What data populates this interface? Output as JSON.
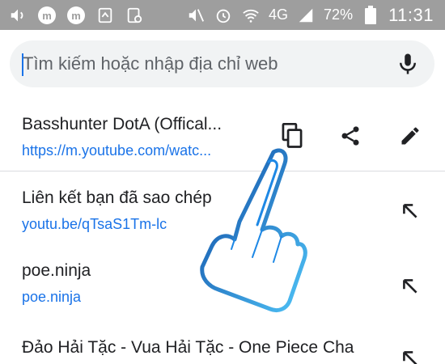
{
  "status_bar": {
    "left_icons": [
      "volume-icon",
      "m-app-icon",
      "m-app-icon",
      "recycle-icon",
      "screenshot-icon"
    ],
    "right_icons": [
      "mute-icon",
      "alarm-icon",
      "wifi-icon",
      "network-4g-icon",
      "signal-icon",
      "battery-icon"
    ],
    "network_label": "4G",
    "battery_percent": "72%",
    "time": "11:31"
  },
  "omnibox": {
    "placeholder": "Tìm kiếm hoặc nhập địa chỉ web",
    "mic_icon": "microphone-icon"
  },
  "clipboard_suggestion": {
    "title": "Basshunter DotA (Offical...",
    "url": "https://m.youtube.com/watc...",
    "actions": [
      "copy-icon",
      "share-icon",
      "edit-icon"
    ]
  },
  "suggestions": [
    {
      "title": "Liên kết bạn đã sao chép",
      "url": "youtu.be/qTsaS1Tm-lc"
    },
    {
      "title": "poe.ninja",
      "url": "poe.ninja"
    },
    {
      "title": "Đảo Hải Tặc - Vua Hải Tặc - One Piece Cha",
      "url": ""
    }
  ],
  "colors": {
    "status_bar": "#9e9e9e",
    "link": "#1a73e8",
    "text": "#202124",
    "omnibox_bg": "#f1f3f4",
    "hand_outline": "#1e88e5"
  }
}
